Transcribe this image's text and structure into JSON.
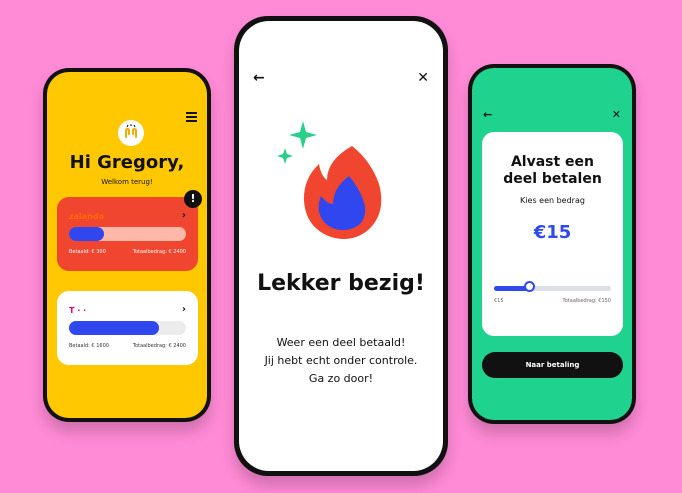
{
  "colors": {
    "background": "#ff8ad6",
    "home_bg": "#ffc800",
    "card_red": "#f0462f",
    "progress_blue": "#3047f0",
    "success_bg": "#1fd38f",
    "flame_red": "#f0462f",
    "sparkle_green": "#2ad08a"
  },
  "home": {
    "greeting": "Hi Gregory,",
    "subtitle": "Welkom terug!",
    "avatar_icon": "waving-hands-icon",
    "menu_icon": "hamburger-menu-icon",
    "alert_symbol": "!",
    "cards": [
      {
        "brand": "zalando",
        "paid_label": "Betaald: € 300",
        "total_label": "Totaalbedrag: € 2400",
        "progress": 0.3
      },
      {
        "brand": "T · ·",
        "paid_label": "Betaald: € 1600",
        "total_label": "Totaalbedrag: € 2400",
        "progress": 0.77
      }
    ]
  },
  "success": {
    "back_icon": "←",
    "close_icon": "✕",
    "title": "Lekker bezig!",
    "message_lines": [
      "Weer een deel betaald!",
      "Jij hebt echt onder controle.",
      "Ga zo door!"
    ]
  },
  "partial_payment": {
    "back_icon": "←",
    "close_icon": "✕",
    "title_line1": "Alvast een",
    "title_line2": "deel betalen",
    "subtitle": "Kies een bedrag",
    "amount": "€15",
    "slider": {
      "min_label": "€15",
      "max_label": "Totaalbedrag: €150",
      "value": 0.3
    },
    "button_label": "Naar betaling"
  }
}
